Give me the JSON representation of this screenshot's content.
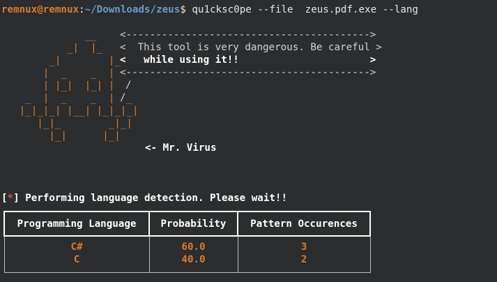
{
  "prompt": {
    "user_host": "remnux@remnux",
    "colon": ":",
    "path": "~/Downloads/zeus",
    "symbol": "$",
    "command": "qu1cksc0pe --file  zeus.pdf.exe --lang"
  },
  "banner": {
    "border_top": "<----------------------------------------->",
    "line1": "<  This tool is very dangerous. Be careful >",
    "line2": "<   while using it!!                      >",
    "border_bottom": "<----------------------------------------->",
    "signature": "<- Mr. Virus"
  },
  "ascii_art": [
    "              __",
    "           _|  |_",
    "        _|        |_",
    "       |  _    _  |",
    "       | |_|  |_| |",
    "    _  |  _    _  |  _",
    "   |_|_|_| |__| |_|_|_|",
    "      |_|_        _|_|",
    "        |_|      |_|"
  ],
  "status": {
    "bracket_open": "[",
    "star": "*",
    "bracket_close": "]",
    "text": "Performing language detection. Please wait!!"
  },
  "table": {
    "headers": [
      "Programming Language",
      "Probability",
      "Pattern Occurences"
    ],
    "rows": [
      [
        "C#",
        "60.0",
        "3"
      ],
      [
        "C",
        "40.0",
        "2"
      ]
    ]
  },
  "colors": {
    "background": "#2b2d2f",
    "accent_orange": "#d97c2a",
    "path_blue": "#6a9bd1",
    "star_red": "#e0503c",
    "text": "#d6d6d6"
  }
}
